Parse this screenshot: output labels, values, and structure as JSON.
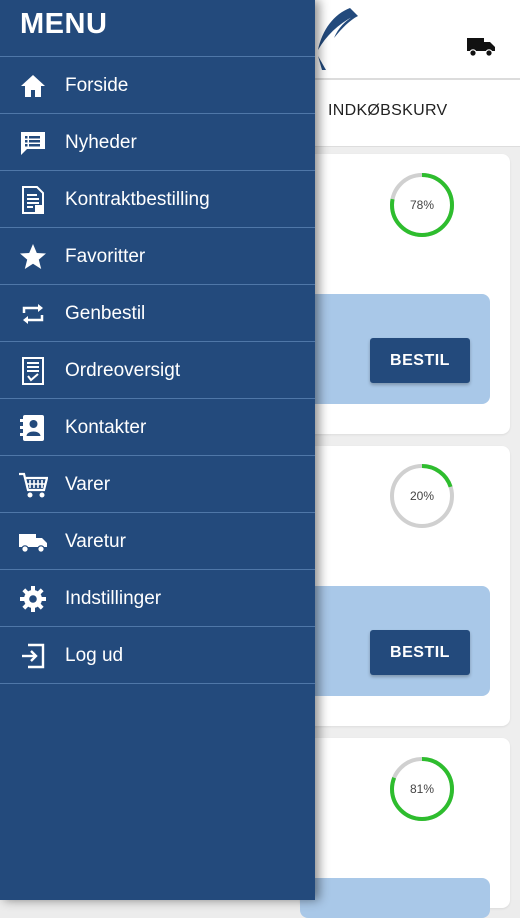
{
  "header": {
    "truck_icon": "truck-icon"
  },
  "tabs": {
    "active_label": "INDKØBSKURV"
  },
  "cards": [
    {
      "progress_label": "78%",
      "progress_value": 0.78,
      "button_label": "BESTIL"
    },
    {
      "progress_label": "20%",
      "progress_value": 0.2,
      "button_label": "BESTIL"
    },
    {
      "progress_label": "81%",
      "progress_value": 0.81
    }
  ],
  "menu": {
    "title": "MENU",
    "items": [
      {
        "label": "Forside",
        "icon": "home-icon"
      },
      {
        "label": "Nyheder",
        "icon": "news-icon"
      },
      {
        "label": "Kontraktbestilling",
        "icon": "contract-icon"
      },
      {
        "label": "Favoritter",
        "icon": "star-icon"
      },
      {
        "label": "Genbestil",
        "icon": "repeat-icon"
      },
      {
        "label": "Ordreoversigt",
        "icon": "order-overview-icon"
      },
      {
        "label": "Kontakter",
        "icon": "contacts-icon"
      },
      {
        "label": "Varer",
        "icon": "cart-icon"
      },
      {
        "label": "Varetur",
        "icon": "truck-icon"
      },
      {
        "label": "Indstillinger",
        "icon": "gear-icon"
      },
      {
        "label": "Log ud",
        "icon": "logout-icon"
      }
    ]
  },
  "colors": {
    "drawer_bg": "#234a7c",
    "divider": "#4f77a8",
    "progress_green": "#2ebd2e",
    "progress_track": "#d0d0d0",
    "card_inner": "#a9c8e8"
  }
}
